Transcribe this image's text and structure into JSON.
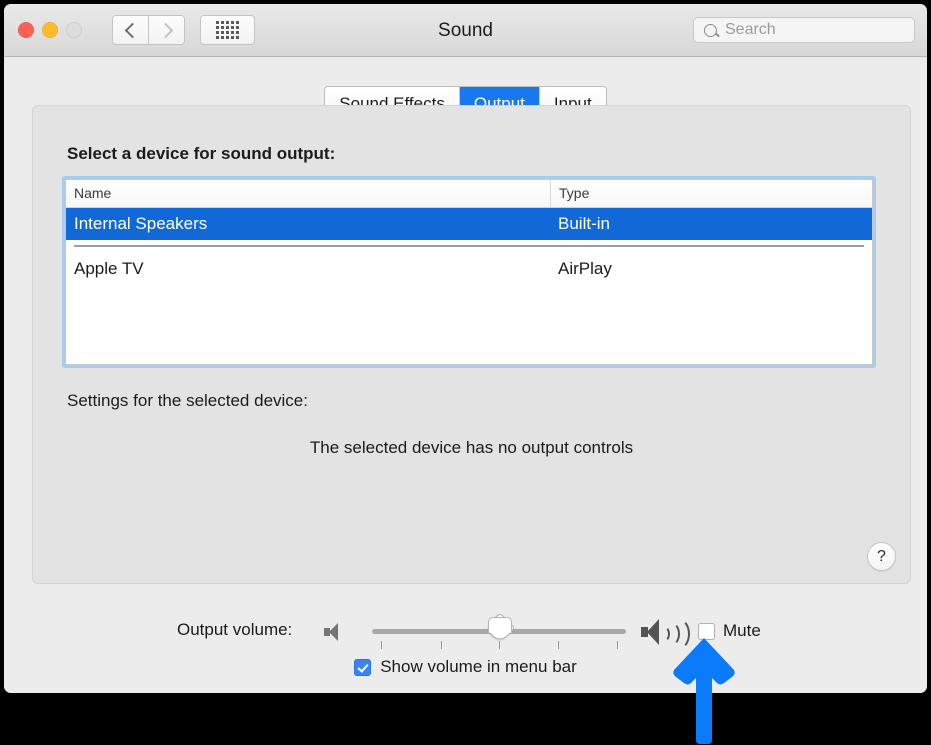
{
  "window": {
    "title": "Sound",
    "traffic_lights": [
      "close",
      "minimize",
      "zoom"
    ],
    "nav_back": "‹",
    "nav_forward": "›",
    "grid_button": "show-all-icon"
  },
  "search": {
    "placeholder": "Search",
    "value": "",
    "icon": "search-icon"
  },
  "tabs": [
    {
      "label": "Sound Effects",
      "active": false
    },
    {
      "label": "Output",
      "active": true
    },
    {
      "label": "Input",
      "active": false
    }
  ],
  "panel": {
    "device_prompt": "Select a device for sound output:",
    "settings_label": "Settings for the selected device:",
    "no_controls_message": "The selected device has no output controls",
    "help_label": "?"
  },
  "device_table": {
    "columns": [
      "Name",
      "Type"
    ],
    "rows": [
      {
        "name": "Internal Speakers",
        "type": "Built-in",
        "selected": true
      },
      {
        "name": "Apple TV",
        "type": "AirPlay",
        "selected": false
      }
    ]
  },
  "volume": {
    "label": "Output volume:",
    "slider_value": 50,
    "slider_min": 0,
    "slider_max": 100,
    "tick_count": 5,
    "low_icon": "speaker-low-icon",
    "high_icon": "speaker-high-icon",
    "mute_label": "Mute",
    "mute_checked": false
  },
  "menubar_option": {
    "label": "Show volume in menu bar",
    "checked": true
  },
  "annotation": {
    "arrow": "up-arrow-pointer",
    "color": "#0b7bfb"
  },
  "colors": {
    "accent": "#1878f0",
    "selection": "#1169d8",
    "window_bg": "#ececec",
    "panel_bg": "#e3e3e3",
    "focus_ring": "#a8cbf0"
  }
}
